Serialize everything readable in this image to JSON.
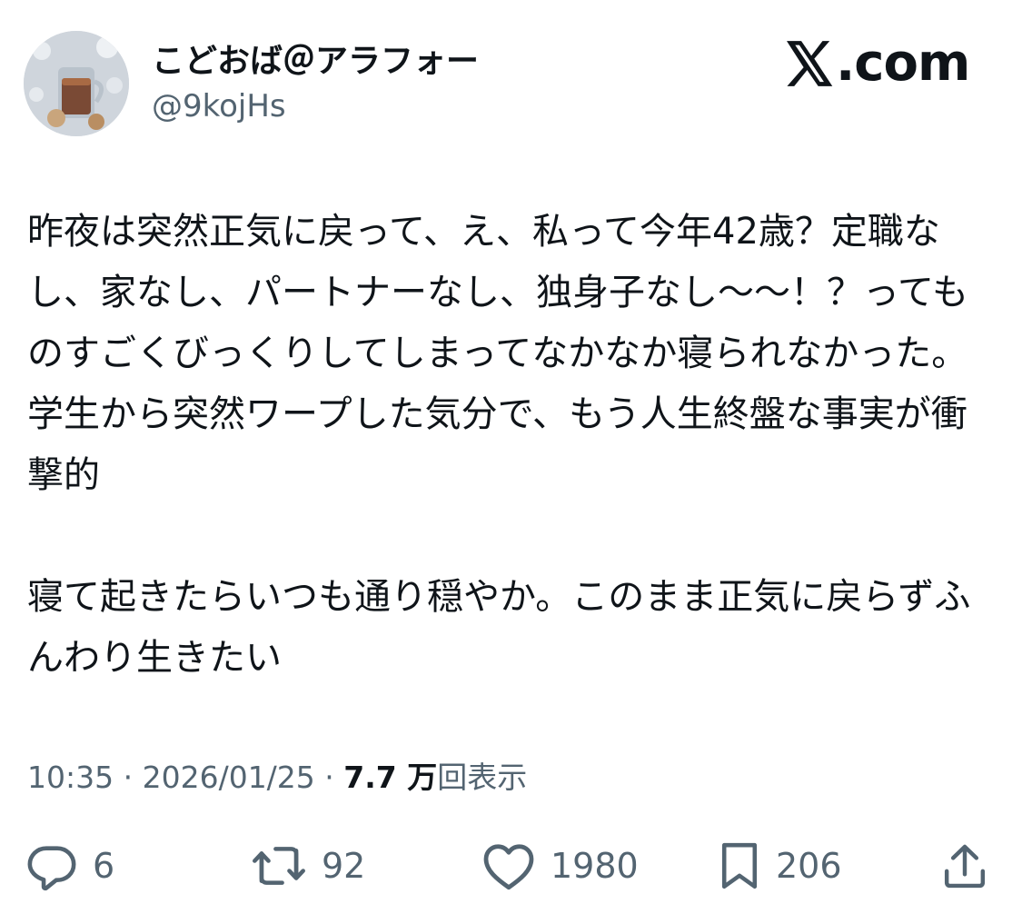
{
  "user": {
    "display_name": "こどおば＠アラフォー",
    "handle": "@9kojHs"
  },
  "brand": {
    "text": ".com",
    "icon": "x-logo-icon"
  },
  "tweet": {
    "text": "昨夜は突然正気に戻って、え、私って今年42歳？定職なし、家なし、パートナーなし、独身子なし〜〜！？ってものすごくびっくりしてしまってなかなか寝られなかった。学生から突然ワープした気分で、もう人生終盤な事実が衝撃的\n\n寝て起きたらいつも通り穏やか。このまま正気に戻らずふんわり生きたい"
  },
  "meta": {
    "time": "10:35",
    "separator": " · ",
    "date": "2026/01/25",
    "views_number": "7.7 万",
    "views_label": "回表示"
  },
  "actions": {
    "reply": {
      "icon": "reply-icon",
      "count": "6"
    },
    "retweet": {
      "icon": "retweet-icon",
      "count": "92"
    },
    "like": {
      "icon": "heart-icon",
      "count": "1980"
    },
    "bookmark": {
      "icon": "bookmark-icon",
      "count": "206"
    },
    "share": {
      "icon": "share-icon"
    }
  },
  "colors": {
    "text_primary": "#0f1419",
    "text_secondary": "#536471",
    "background": "#ffffff"
  }
}
